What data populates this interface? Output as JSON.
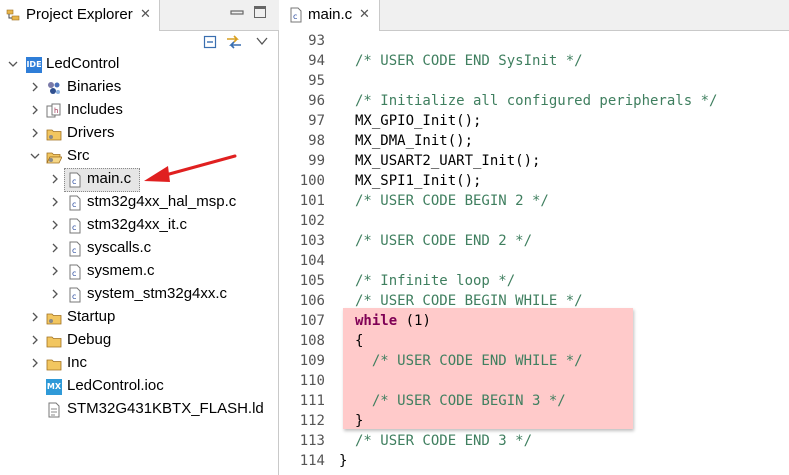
{
  "project_explorer": {
    "tab_title": "Project Explorer",
    "tab_close": "✕",
    "toolbar": {
      "collapse_icon": "collapse-all-icon",
      "link_icon": "link-with-editor-icon",
      "view_menu_icon": "view-menu-icon"
    },
    "tree": {
      "project": {
        "label": "LedControl",
        "badge": "IDE",
        "expanded": true
      },
      "children": [
        {
          "label": "Binaries",
          "icon": "binaries-icon",
          "expanded": false
        },
        {
          "label": "Includes",
          "icon": "includes-icon",
          "expanded": false
        },
        {
          "label": "Drivers",
          "icon": "folder-icon",
          "expanded": false
        },
        {
          "label": "Src",
          "icon": "folder-icon",
          "expanded": true,
          "files": [
            {
              "label": "main.c",
              "selected": true
            },
            {
              "label": "stm32g4xx_hal_msp.c"
            },
            {
              "label": "stm32g4xx_it.c"
            },
            {
              "label": "syscalls.c"
            },
            {
              "label": "sysmem.c"
            },
            {
              "label": "system_stm32g4xx.c"
            }
          ]
        },
        {
          "label": "Startup",
          "icon": "folder-icon",
          "expanded": false
        },
        {
          "label": "Debug",
          "icon": "folder-icon",
          "expanded": false
        },
        {
          "label": "Inc",
          "icon": "folder-icon",
          "expanded": false
        },
        {
          "label": "LedControl.ioc",
          "icon": "mx-icon",
          "badge": "MX"
        },
        {
          "label": "STM32G431KBTX_FLASH.ld",
          "icon": "linker-file-icon"
        }
      ]
    }
  },
  "editor": {
    "tab_title": "main.c",
    "tab_close": "✕",
    "lines": [
      {
        "num": "93",
        "text": "",
        "kind": "plain"
      },
      {
        "num": "94",
        "text": "/* USER CODE END SysInit */",
        "kind": "comment"
      },
      {
        "num": "95",
        "text": "",
        "kind": "plain"
      },
      {
        "num": "96",
        "text": "/* Initialize all configured peripherals */",
        "kind": "comment"
      },
      {
        "num": "97",
        "text": "MX_GPIO_Init();",
        "kind": "plain"
      },
      {
        "num": "98",
        "text": "MX_DMA_Init();",
        "kind": "plain"
      },
      {
        "num": "99",
        "text": "MX_USART2_UART_Init();",
        "kind": "plain"
      },
      {
        "num": "100",
        "text": "MX_SPI1_Init();",
        "kind": "plain"
      },
      {
        "num": "101",
        "text": "/* USER CODE BEGIN 2 */",
        "kind": "comment"
      },
      {
        "num": "102",
        "text": "",
        "kind": "plain"
      },
      {
        "num": "103",
        "text": "/* USER CODE END 2 */",
        "kind": "comment"
      },
      {
        "num": "104",
        "text": "",
        "kind": "plain"
      },
      {
        "num": "105",
        "text": "/* Infinite loop */",
        "kind": "comment"
      },
      {
        "num": "106",
        "text": "/* USER CODE BEGIN WHILE */",
        "kind": "comment"
      },
      {
        "num": "107",
        "keyword": "while",
        "text": " (1)",
        "kind": "keyword"
      },
      {
        "num": "108",
        "text": "{",
        "kind": "plain"
      },
      {
        "num": "109",
        "text": "  /* USER CODE END WHILE */",
        "kind": "comment"
      },
      {
        "num": "110",
        "text": "",
        "kind": "plain"
      },
      {
        "num": "111",
        "text": "  /* USER CODE BEGIN 3 */",
        "kind": "comment"
      },
      {
        "num": "112",
        "text": "}",
        "kind": "plain"
      },
      {
        "num": "113",
        "text": "/* USER CODE END 3 */",
        "kind": "comment"
      },
      {
        "num": "114",
        "text": "}",
        "kind": "plain-outer"
      }
    ]
  },
  "colors": {
    "comment": "#3f7f5f",
    "keyword": "#7f0055",
    "highlight": "#ffcaca",
    "arrow": "#e02020",
    "folder": "#e8b64c"
  }
}
